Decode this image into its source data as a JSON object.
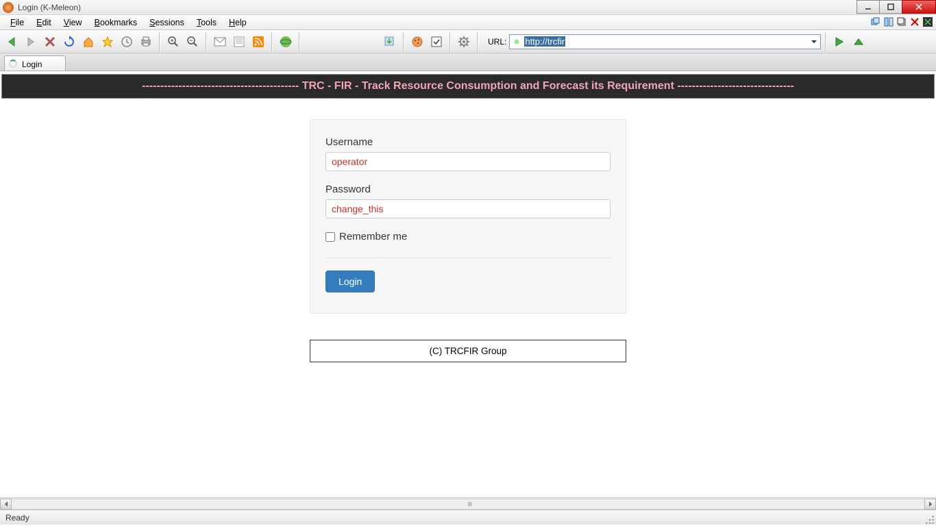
{
  "window": {
    "title": "Login (K-Meleon)"
  },
  "menus": {
    "file": "File",
    "edit": "Edit",
    "view": "View",
    "bookmarks": "Bookmarks",
    "sessions": "Sessions",
    "tools": "Tools",
    "help": "Help"
  },
  "url": {
    "label": "URL:",
    "value": "http://trcfir"
  },
  "tab": {
    "label": "Login"
  },
  "banner": "------------------------------------------- TRC - FIR - Track Resource Consumption and Forecast its Requirement --------------------------------",
  "form": {
    "username_label": "Username",
    "username_value": "operator",
    "password_label": "Password",
    "password_value": "change_this",
    "remember_label": "Remember me",
    "login_label": "Login"
  },
  "footer": "(C) TRCFIR Group",
  "status": "Ready"
}
